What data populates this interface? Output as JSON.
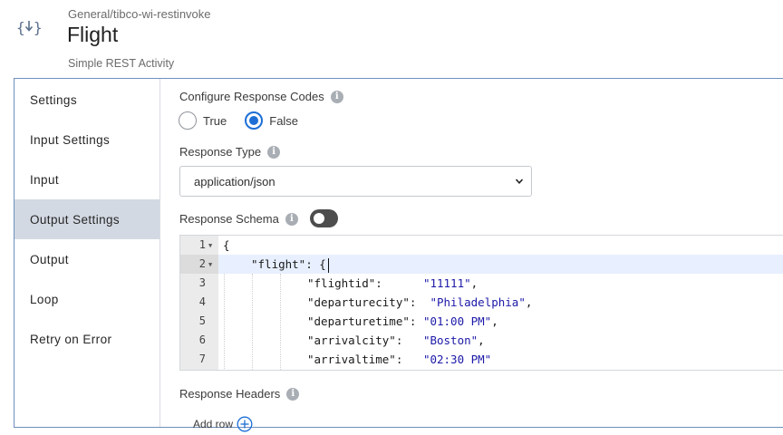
{
  "header": {
    "icon": "download-braces-icon",
    "breadcrumb": "General/tibco-wi-restinvoke",
    "title": "Flight",
    "subtitle": "Simple REST Activity"
  },
  "sidebar": {
    "items": [
      {
        "label": "Settings",
        "active": false
      },
      {
        "label": "Input Settings",
        "active": false
      },
      {
        "label": "Input",
        "active": false
      },
      {
        "label": "Output Settings",
        "active": true
      },
      {
        "label": "Output",
        "active": false
      },
      {
        "label": "Loop",
        "active": false
      },
      {
        "label": "Retry on Error",
        "active": false
      }
    ]
  },
  "content": {
    "configure_response_codes": {
      "label": "Configure Response Codes",
      "options": [
        "True",
        "False"
      ],
      "selected": "False"
    },
    "response_type": {
      "label": "Response Type",
      "value": "application/json"
    },
    "response_schema": {
      "label": "Response Schema",
      "toggle_on": false
    },
    "editor": {
      "lines": [
        {
          "num": "1",
          "fold": true,
          "text": "{"
        },
        {
          "num": "2",
          "fold": true,
          "text": "\"flight\": {",
          "active": true
        },
        {
          "num": "3",
          "key": "\"flightid\":",
          "value": "\"11111\"",
          "sep": ","
        },
        {
          "num": "4",
          "key": "\"departurecity\":",
          "value": "\"Philadelphia\"",
          "sep": ","
        },
        {
          "num": "5",
          "key": "\"departuretime\":",
          "value": "\"01:00 PM\"",
          "sep": ","
        },
        {
          "num": "6",
          "key": "\"arrivalcity\":",
          "value": "\"Boston\"",
          "sep": ","
        },
        {
          "num": "7",
          "key": "\"arrivaltime\":",
          "value": "\"02:30 PM\"",
          "sep": ""
        }
      ]
    },
    "response_headers": {
      "label": "Response Headers",
      "add_row_label": "Add row"
    }
  },
  "colors": {
    "accent": "#1d6fd6",
    "active_sidebar": "#d3d9e3",
    "string_value": "#1c19a8"
  }
}
